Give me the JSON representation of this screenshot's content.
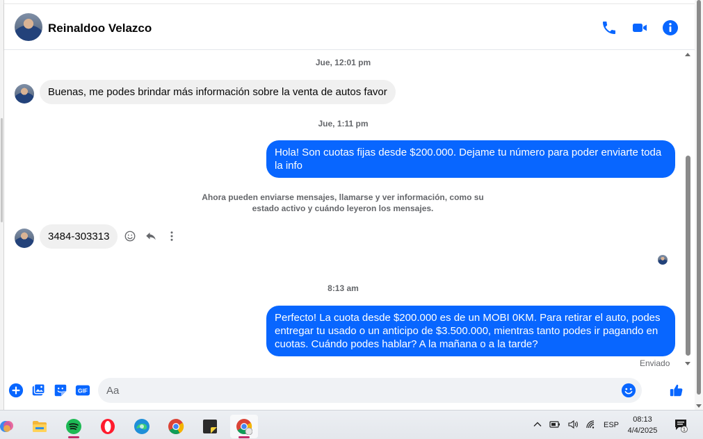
{
  "chat": {
    "contact_name": "Reinaldoo Velazco",
    "header_icons": [
      "phone-icon",
      "video-icon",
      "info-icon"
    ],
    "messages": [
      {
        "type": "timestamp",
        "text": "Jue, 12:01 pm"
      },
      {
        "type": "incoming",
        "text": "Buenas, me podes brindar más información sobre la venta de autos favor"
      },
      {
        "type": "timestamp",
        "text": "Jue, 1:11 pm"
      },
      {
        "type": "outgoing",
        "text": "Hola! Son cuotas fijas desde $200.000. Dejame tu número para poder enviarte toda la info"
      },
      {
        "type": "notice",
        "text": "Ahora pueden enviarse mensajes, llamarse y ver información, como su estado activo y cuándo leyeron los mensajes."
      },
      {
        "type": "incoming",
        "text": "3484-303313"
      },
      {
        "type": "timestamp",
        "text": "8:13 am"
      },
      {
        "type": "outgoing",
        "text": "Perfecto! La cuota desde $200.000 es de un MOBI 0KM. Para retirar el auto, podes entregar tu usado o un anticipo de $3.500.000, mientras tanto podes ir pagando en cuotas. Cuándo podes hablar? A la mañana o a la tarde?"
      }
    ],
    "status": "Enviado"
  },
  "composer": {
    "placeholder": "Aa",
    "gif_label": "GIF",
    "icons": [
      "plus-icon",
      "photo-icon",
      "sticker-icon",
      "gif-icon",
      "emoji-icon",
      "thumbs-up-icon"
    ]
  },
  "taskbar": {
    "apps": [
      "copilot",
      "file-explorer",
      "spotify",
      "opera",
      "edge",
      "chrome",
      "sticky-notes",
      "chrome-profile"
    ],
    "language": "ESP",
    "time": "08:13",
    "date": "4/4/2025",
    "notification_count": "1"
  },
  "colors": {
    "accent": "#0866ff",
    "incoming_bubble": "#f0f0f0",
    "taskbar_indicator": "#c42b6b"
  }
}
